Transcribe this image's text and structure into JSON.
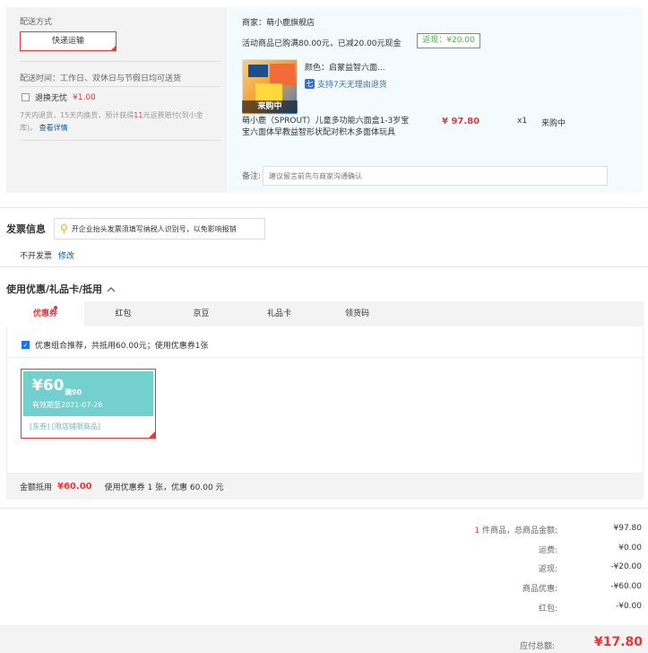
{
  "shipping": {
    "title": "配送方式",
    "method": "快递运输",
    "time": "配送时间：工作日、双休日与节假日均可送货",
    "returns_label": "退换无忧",
    "returns_price": "¥1.00",
    "returns_note_a": "7天内退货，15天内换货，预计获得",
    "returns_note_highlight": "11",
    "returns_note_b": "元运费赔付(到小金库)。",
    "returns_link": "查看详情"
  },
  "order": {
    "merchant": "商家：萌小鹿旗舰店",
    "promo": "活动商品已购满80.00元，已减20.00元现金",
    "rebate": "返现：¥20.00",
    "thumb_label": "来购中",
    "color": "颜色：启蒙益智六面...",
    "return_tag": "支持7天无理由退货",
    "title": "萌小鹿（SPROUT）儿童多功能六面盒1-3岁宝宝六面体早教益智形状配对积木多面体玩具",
    "price": "¥ 97.80",
    "qty": "x1",
    "status": "来购中",
    "note_label": "备注:",
    "note_placeholder": "建议留言前先与商家沟通确认"
  },
  "invoice": {
    "title": "发票信息",
    "tip": "开企业抬头发票须填写纳税人识别号，以免影响报销",
    "status": "不开发票",
    "modify": "修改"
  },
  "coupon": {
    "title": "使用优惠/礼品卡/抵用",
    "tabs": [
      "优惠券",
      "红包",
      "京豆",
      "礼品卡",
      "领货码"
    ],
    "combo": "优惠组合推荐，共抵用60.00元；使用优惠券1张",
    "card": {
      "amount": "¥60",
      "condition": "满90",
      "expiry": "有效期至2021-07-26",
      "tag1": "[东券]",
      "tag2": "[限店铺限商品]"
    },
    "deduct_label": "金额抵用",
    "deduct_amount": "¥60.00",
    "deduct_detail": "使用优惠券 1 张，优惠 60.00 元"
  },
  "summary": {
    "count": "1",
    "count_suffix": "件商品，总商品金额:",
    "goods_total": "¥97.80",
    "freight_label": "运费:",
    "freight": "¥0.00",
    "cashback_label": "返现:",
    "cashback": "-¥20.00",
    "discount_label": "商品优惠:",
    "discount": "-¥60.00",
    "redpack_label": "红包:",
    "redpack": "-¥0.00",
    "total_label": "应付总额:",
    "total": "¥17.80"
  },
  "colors": {
    "accent": "#e4393c",
    "link": "#005ea7",
    "coupon": "#74cfcf",
    "rebate": "#4cae4c"
  }
}
